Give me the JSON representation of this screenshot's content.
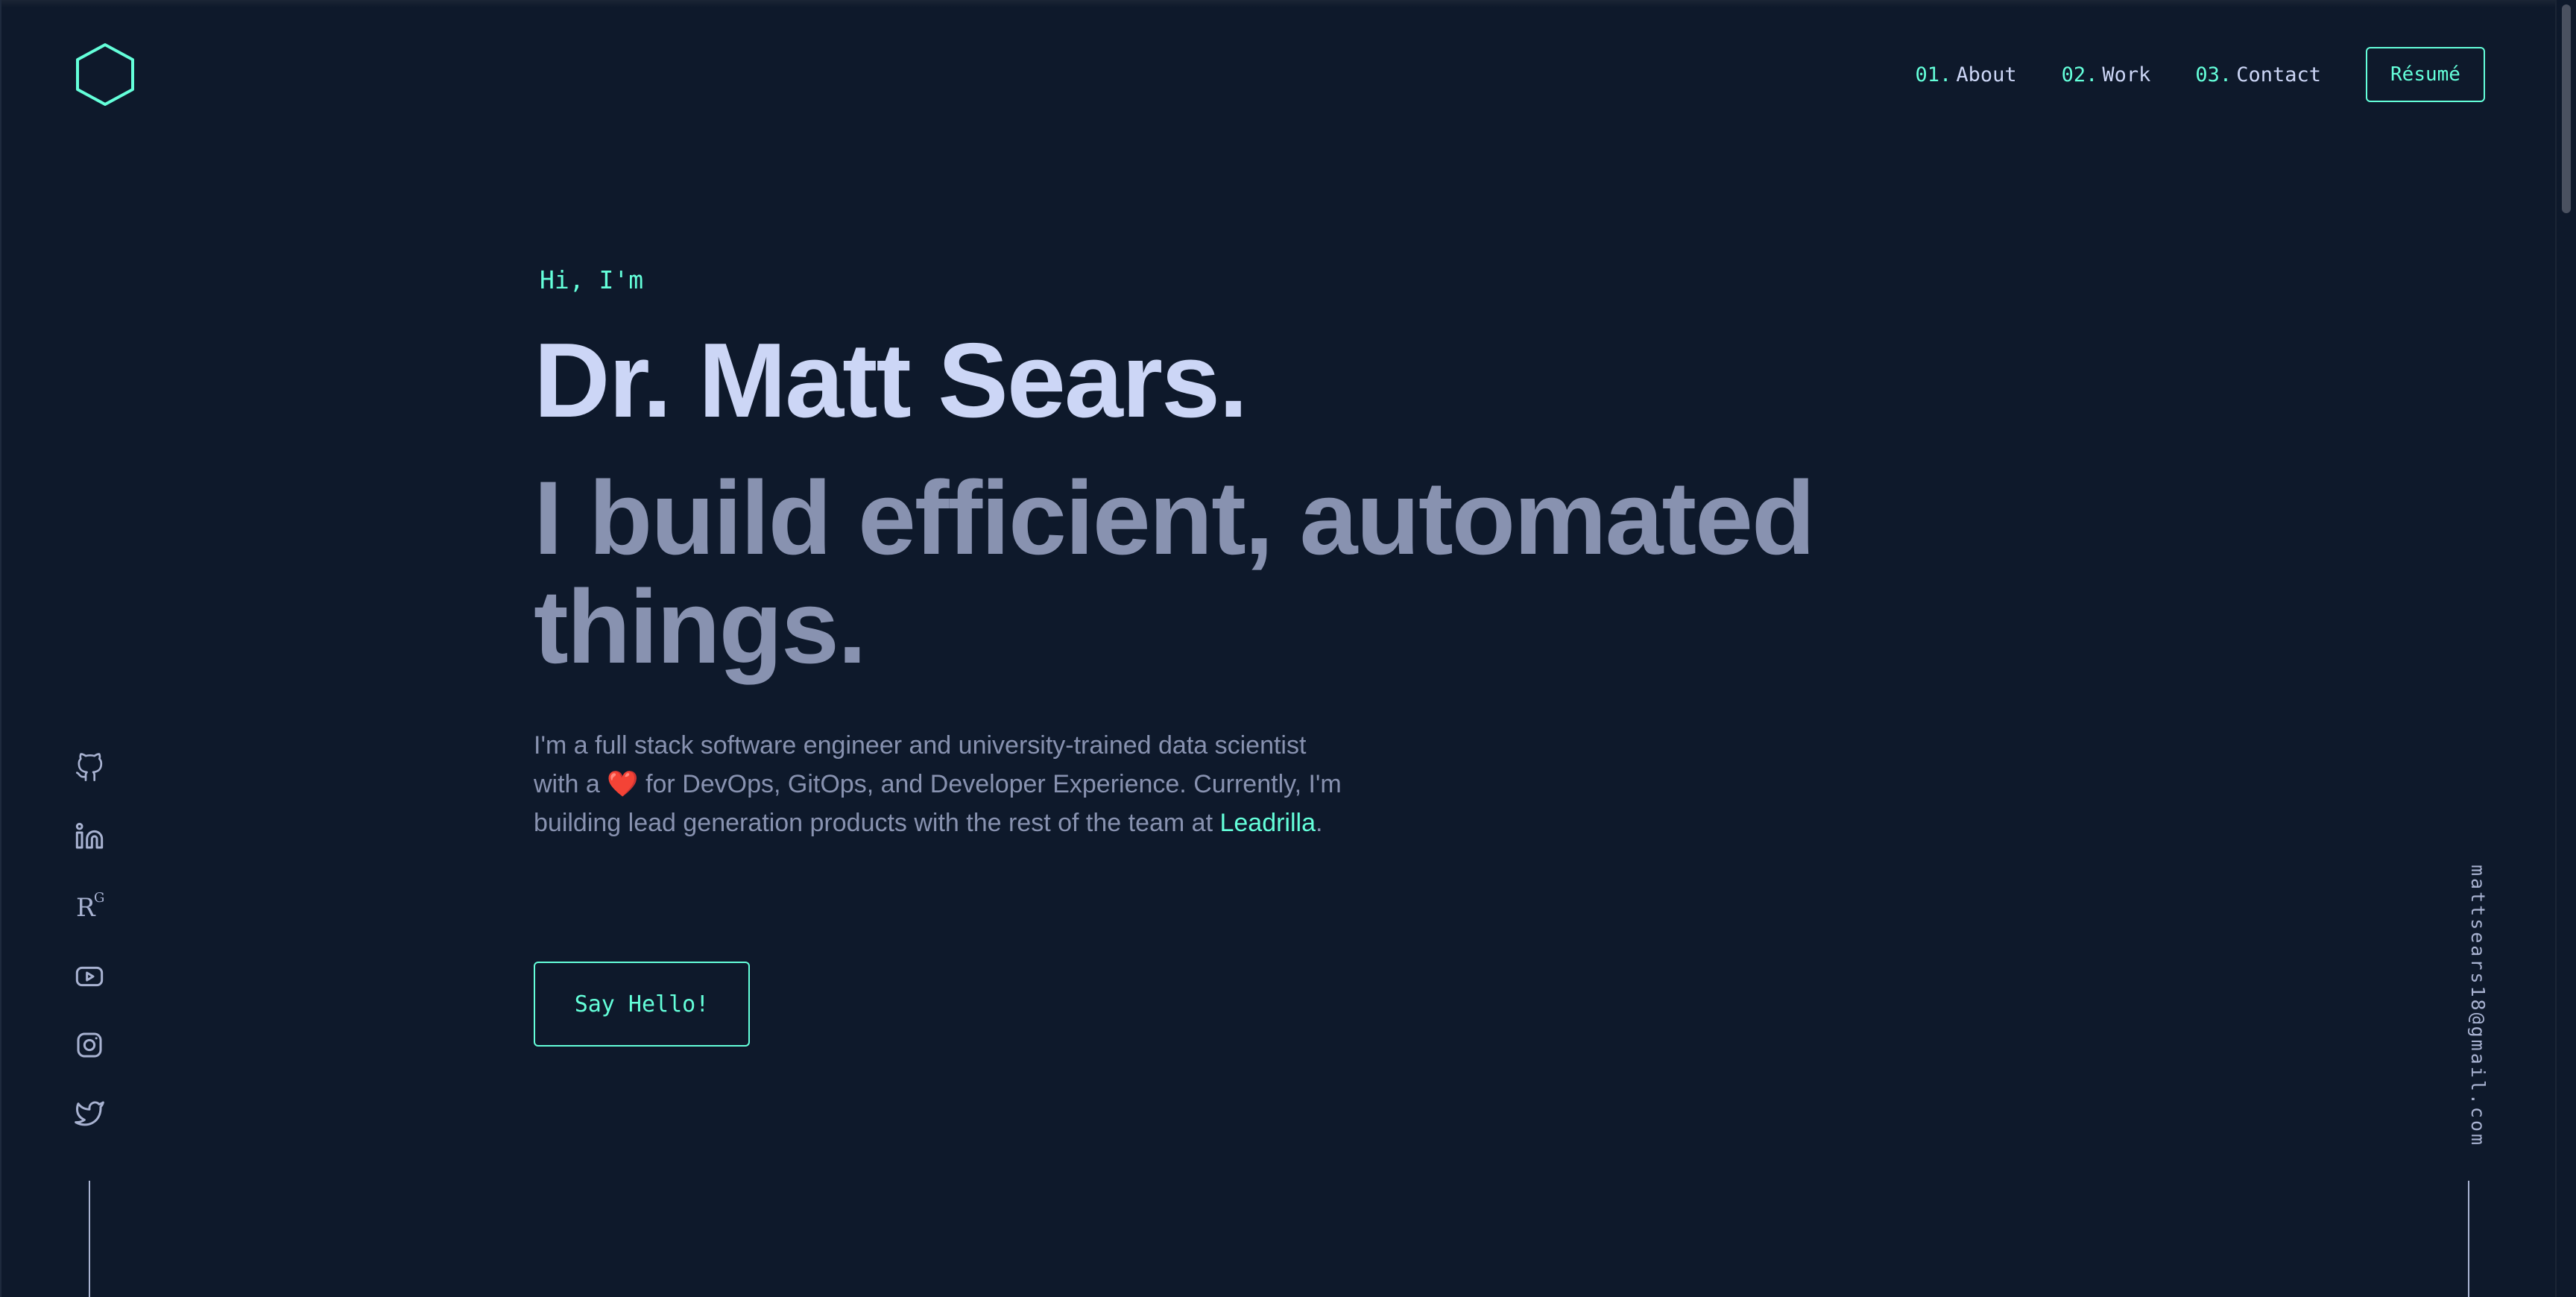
{
  "nav": {
    "items": [
      {
        "num": "01.",
        "label": "About"
      },
      {
        "num": "02.",
        "label": "Work"
      },
      {
        "num": "03.",
        "label": "Contact"
      }
    ],
    "resume_label": "Résumé"
  },
  "hero": {
    "greeting": "Hi, I'm",
    "name": "Dr. Matt Sears.",
    "tagline": "I build efficient, automated things.",
    "intro_part1": "I'm a full stack software engineer and university-trained data scientist with a",
    "intro_heart": "❤️",
    "intro_part2": "for DevOps, GitOps, and Developer Experience. Currently, I'm building lead generation products with the rest of the team at",
    "intro_link": "Leadrilla",
    "intro_end": ".",
    "button_label": "Say Hello!"
  },
  "social": {
    "icons": [
      "github-icon",
      "linkedin-icon",
      "researchgate-icon",
      "youtube-icon",
      "instagram-icon",
      "twitter-icon"
    ],
    "researchgate_r": "R",
    "researchgate_g": "G"
  },
  "email": "mattsears18@gmail.com",
  "colors": {
    "background": "#0e192b",
    "accent": "#64ffda",
    "heading": "#ccd6f6",
    "body": "#8892b0"
  }
}
